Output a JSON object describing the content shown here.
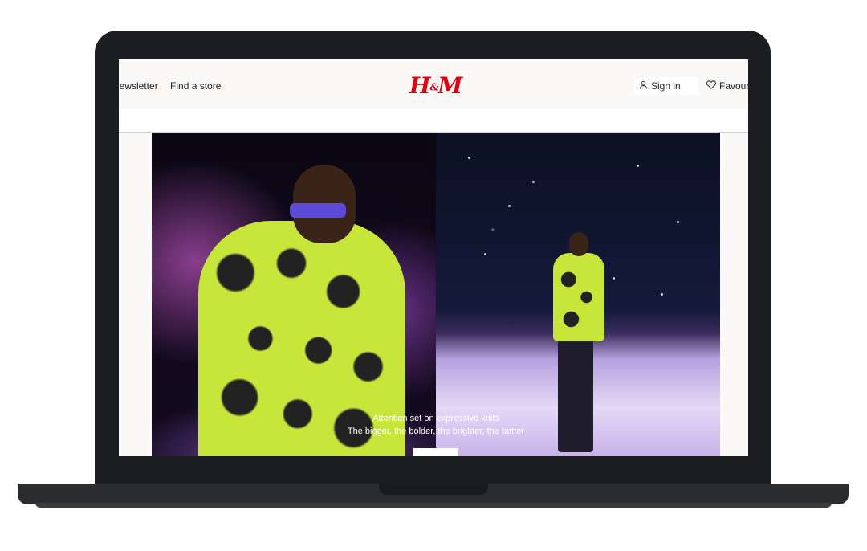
{
  "header": {
    "nav_left": [
      "Newsletter",
      "Find a store"
    ],
    "logo": "H&M",
    "sign_in": "Sign in",
    "favourites": "Favourites"
  },
  "hero": {
    "title": "Attention set on expressive knits",
    "subtitle": "The bigger, the bolder, the brighter, the better"
  },
  "colors": {
    "brand": "#e50010",
    "sweater": "#c8e63a",
    "laptop": "#1b1d20"
  },
  "icons": {
    "sign_in": "user-icon",
    "favourites": "heart-icon"
  }
}
